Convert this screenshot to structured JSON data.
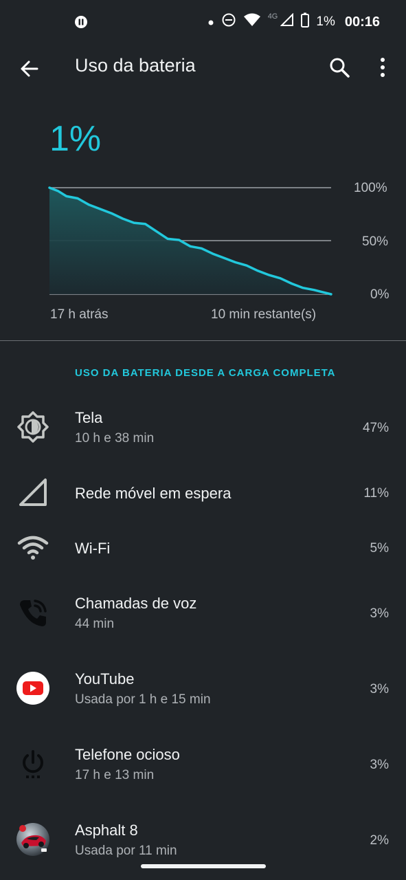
{
  "status_bar": {
    "network": "4G",
    "battery_pct": "1%",
    "time": "00:16"
  },
  "toolbar": {
    "title": "Uso da bateria"
  },
  "battery": {
    "level": "1%"
  },
  "chart_data": {
    "type": "area",
    "y_ticks": [
      "100%",
      "50%",
      "0%"
    ],
    "x_labels": [
      "17 h atrás",
      "10 min restante(s)"
    ],
    "ylim": [
      0,
      100
    ],
    "xlim": [
      0,
      1
    ],
    "x": [
      0.0,
      0.03,
      0.06,
      0.1,
      0.14,
      0.18,
      0.22,
      0.26,
      0.3,
      0.34,
      0.38,
      0.42,
      0.46,
      0.5,
      0.54,
      0.58,
      0.62,
      0.66,
      0.7,
      0.74,
      0.78,
      0.82,
      0.86,
      0.9,
      0.94,
      0.97,
      1.0
    ],
    "values": [
      100,
      97,
      92,
      90,
      84,
      80,
      76,
      71,
      67,
      66,
      59,
      52,
      51,
      45,
      43,
      38,
      34,
      30,
      27,
      22,
      18,
      15,
      10,
      6,
      4,
      2,
      0
    ],
    "color": "#22c8dc",
    "grid": true
  },
  "section": {
    "title": "USO DA BATERIA DESDE A CARGA COMPLETA"
  },
  "items": [
    {
      "icon": "brightness-icon",
      "name": "Tela",
      "sub": "10 h e 38 min",
      "value": "47%"
    },
    {
      "icon": "cell-signal-icon",
      "name": "Rede móvel em espera",
      "sub": "",
      "value": "11%"
    },
    {
      "icon": "wifi-icon",
      "name": "Wi-Fi",
      "sub": "",
      "value": "5%"
    },
    {
      "icon": "phone-call-icon",
      "name": "Chamadas de voz",
      "sub": "44 min",
      "value": "3%"
    },
    {
      "icon": "youtube-icon",
      "name": "YouTube",
      "sub": "Usada por 1 h e 15 min",
      "value": "3%"
    },
    {
      "icon": "power-idle-icon",
      "name": "Telefone ocioso",
      "sub": "17 h e 13 min",
      "value": "3%"
    },
    {
      "icon": "asphalt-app-icon",
      "name": "Asphalt 8",
      "sub": "Usada por 11 min",
      "value": "2%"
    }
  ]
}
